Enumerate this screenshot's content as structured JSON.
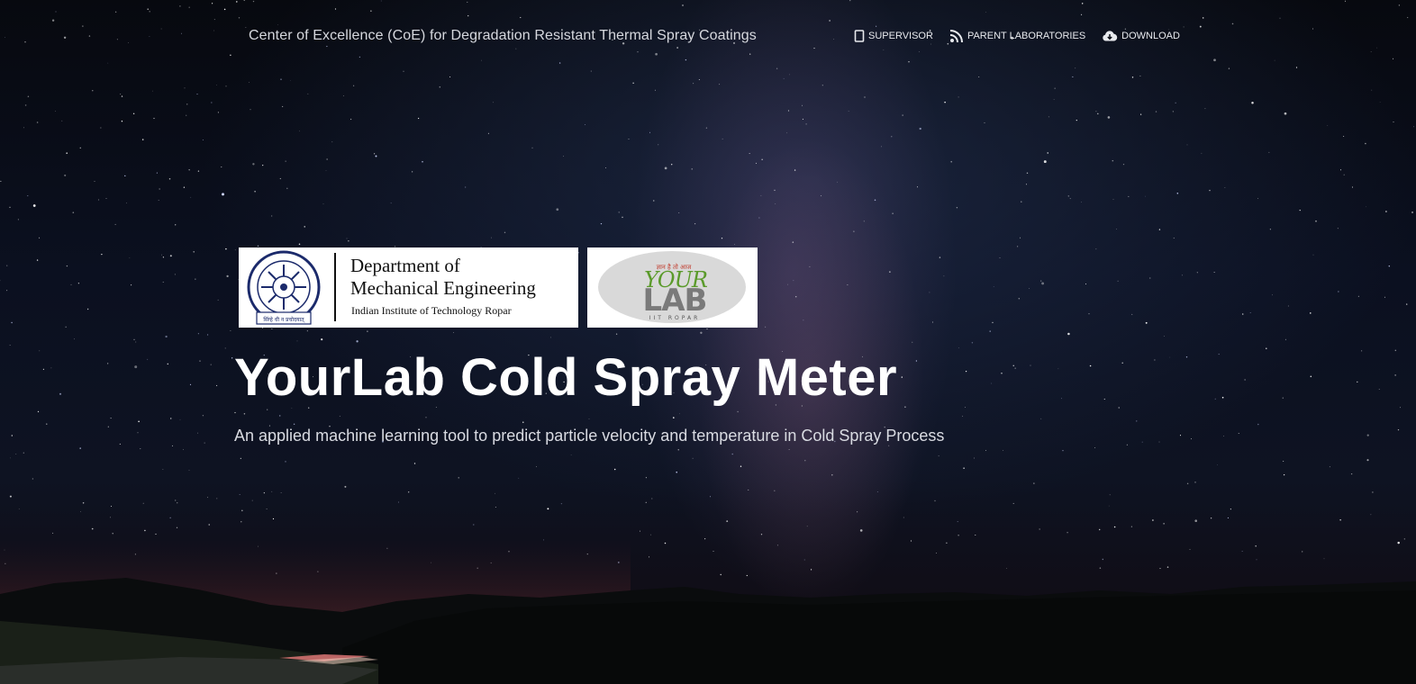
{
  "header": {
    "site_title": "Center of Excellence (CoE) for Degradation Resistant Thermal Spray Coatings",
    "nav": [
      {
        "label": "SUPERVISOR",
        "icon": "tablet-icon"
      },
      {
        "label": "PARENT LABORATORIES",
        "icon": "rss-icon"
      },
      {
        "label": "DOWNLOAD",
        "icon": "cloud-download-icon"
      }
    ]
  },
  "logos": {
    "department": {
      "line1": "Department of",
      "line2": "Mechanical Engineering",
      "institute": "Indian Institute of Technology Ropar",
      "seal_caption": "सिंग्हे धी न प्रचोदयात्"
    },
    "yourlab": {
      "tagline": "ज्ञान है तो आज ",
      "name_top": "YOUR",
      "name_bottom": "LAB",
      "sub": "IIT ROPAR"
    }
  },
  "hero": {
    "title": "YourLab Cold Spray Meter",
    "subtitle": "An applied machine learning tool to predict particle velocity and temperature in Cold Spray Process"
  },
  "colors": {
    "sky_dark": "#07090f",
    "milky_way": "#9a6eaa",
    "text_white": "#ffffff",
    "text_muted": "#d6d8de",
    "yourlab_green": "#5a9a2a"
  }
}
